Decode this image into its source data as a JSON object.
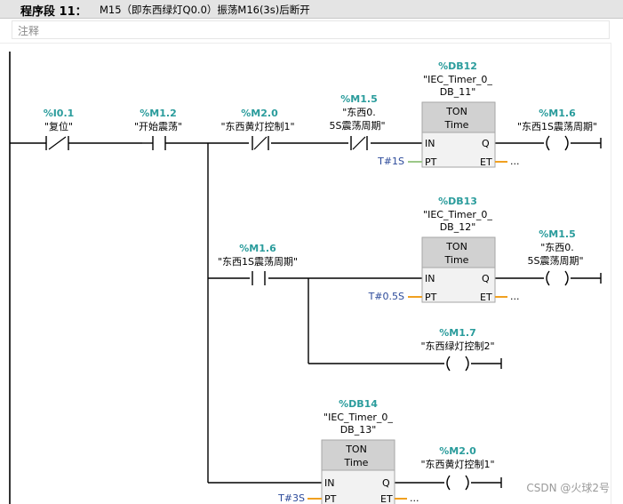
{
  "network": {
    "label": "程序段 11：",
    "title": "M15（即东西绿灯Q0.0）振荡M16(3s)后断开",
    "comment_placeholder": "注释"
  },
  "contacts": [
    {
      "addr": "%I0.1",
      "tag": "\"复位\"",
      "type": "nc"
    },
    {
      "addr": "%M1.2",
      "tag": "\"开始震荡\"",
      "type": "no"
    },
    {
      "addr": "%M2.0",
      "tag": "\"东西黄灯控制1\"",
      "type": "nc"
    },
    {
      "addr": "%M1.5",
      "tag_line1": "\"东西0.",
      "tag_line2": "5S震荡周期\"",
      "type": "nc"
    },
    {
      "addr": "%M1.6",
      "tag": "\"东西1S震荡周期\"",
      "type": "no"
    }
  ],
  "timers": [
    {
      "db": "%DB12",
      "inst_line1": "\"IEC_Timer_0_",
      "inst_line2": "DB_11\"",
      "type": "TON",
      "sub": "Time",
      "pin_in": "IN",
      "pin_pt": "PT",
      "pin_q": "Q",
      "pin_et": "ET",
      "pt_value": "T#1S",
      "et_value": "..."
    },
    {
      "db": "%DB13",
      "inst_line1": "\"IEC_Timer_0_",
      "inst_line2": "DB_12\"",
      "type": "TON",
      "sub": "Time",
      "pin_in": "IN",
      "pin_pt": "PT",
      "pin_q": "Q",
      "pin_et": "ET",
      "pt_value": "T#0.5S",
      "et_value": "..."
    },
    {
      "db": "%DB14",
      "inst_line1": "\"IEC_Timer_0_",
      "inst_line2": "DB_13\"",
      "type": "TON",
      "sub": "Time",
      "pin_in": "IN",
      "pin_pt": "PT",
      "pin_q": "Q",
      "pin_et": "ET",
      "pt_value": "T#3S",
      "et_value": "..."
    }
  ],
  "coils": [
    {
      "addr": "%M1.6",
      "tag": "\"东西1S震荡周期\""
    },
    {
      "addr": "%M1.5",
      "tag_line1": "\"东西0.",
      "tag_line2": "5S震荡周期\""
    },
    {
      "addr": "%M1.7",
      "tag": "\"东西绿灯控制2\""
    },
    {
      "addr": "%M2.0",
      "tag": "\"东西黄灯控制1\""
    }
  ],
  "watermark": "CSDN @火球2号"
}
